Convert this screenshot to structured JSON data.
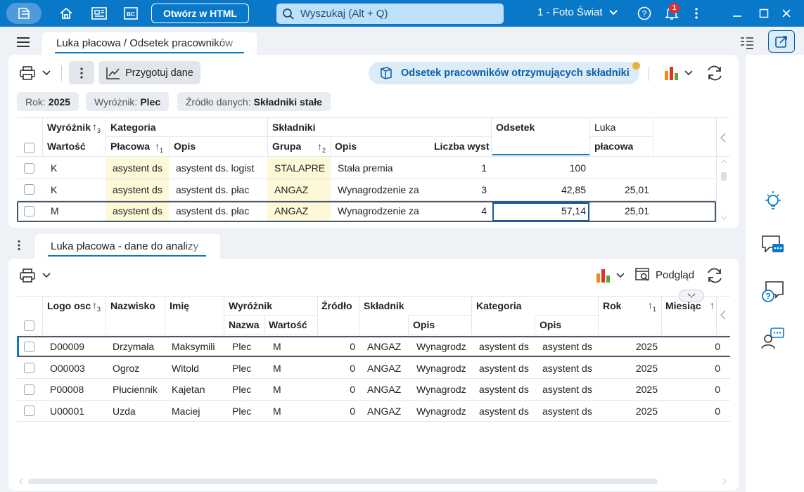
{
  "titlebar": {
    "html_button": "Otwórz w HTML",
    "search_placeholder": "Wyszukaj (Alt + Q)",
    "company": "1 - Foto Świat",
    "notification_count": "1"
  },
  "tabs": {
    "main_tab": "Luka płacowa / Odsetek pracowników",
    "bottom_tab": "Luka płacowa - dane do analizy"
  },
  "toolbar": {
    "prepare_button": "Przygotuj dane",
    "analysis_button": "Odsetek pracowników otrzymujących składniki",
    "preview_button": "Podgląd"
  },
  "filters": [
    {
      "label": "Rok:",
      "value": "2025"
    },
    {
      "label": "Wyróżnik:",
      "value": "Plec"
    },
    {
      "label": "Źródło danych:",
      "value": "Składniki stałe"
    }
  ],
  "top_grid": {
    "group_headers": {
      "wyroznik": "Wyróżnik",
      "kategoria": "Kategoria",
      "skladniki": "Składniki",
      "odsetek": "Odsetek",
      "luka": "Luka"
    },
    "sub_headers": {
      "wartosc": "Wartość",
      "placowa": "Płacowa",
      "opis": "Opis",
      "grupa": "Grupa",
      "opis2": "Opis",
      "liczba": "Liczba wyst",
      "luka2": "płacowa"
    },
    "sort_marks": {
      "wyroznik": "3",
      "placowa": "1",
      "grupa": "2"
    },
    "rows": [
      {
        "wartosc": "K",
        "placowa": "asystent ds",
        "opis": "asystent ds. logist",
        "grupa": "STALAPRE",
        "opis2": "Stała premia",
        "liczba": "1",
        "odsetek": "100",
        "luka": ""
      },
      {
        "wartosc": "K",
        "placowa": "asystent ds",
        "opis": "asystent ds. płac",
        "grupa": "ANGAZ",
        "opis2": "Wynagrodzenie za",
        "liczba": "3",
        "odsetek": "42,85",
        "luka": "25,01"
      },
      {
        "wartosc": "M",
        "placowa": "asystent ds",
        "opis": "asystent ds. płac",
        "grupa": "ANGAZ",
        "opis2": "Wynagrodzenie za",
        "liczba": "4",
        "odsetek": "57,14",
        "luka": "25,01"
      }
    ]
  },
  "bottom_grid": {
    "headers": {
      "logo": "Logo osc",
      "nazwisko": "Nazwisko",
      "imie": "Imię",
      "wyroznik": "Wyróżnik",
      "zrodlo": "Źródło",
      "skladnik": "Składnik",
      "kategoria": "Kategoria",
      "rok": "Rok",
      "miesiac": "Miesiąc"
    },
    "sub_headers": {
      "nazwa": "Nazwa",
      "wartosc": "Wartość",
      "opis": "Opis",
      "opis2": "Opis"
    },
    "sort_marks": {
      "logo": "3",
      "rok": "1"
    },
    "rows": [
      {
        "logo": "D00009",
        "nazwisko": "Drzymała",
        "imie": "Maksymili",
        "nazwa": "Plec",
        "wartosc": "M",
        "zrodlo": "0",
        "skladnik": "ANGAZ",
        "opis": "Wynagrodz",
        "kategoria": "asystent ds",
        "opis2": "asystent ds",
        "rok": "2025",
        "miesiac": "0"
      },
      {
        "logo": "O00003",
        "nazwisko": "Ogroz",
        "imie": "Witold",
        "nazwa": "Plec",
        "wartosc": "M",
        "zrodlo": "0",
        "skladnik": "ANGAZ",
        "opis": "Wynagrodz",
        "kategoria": "asystent ds",
        "opis2": "asystent ds",
        "rok": "2025",
        "miesiac": "0"
      },
      {
        "logo": "P00008",
        "nazwisko": "Płuciennik",
        "imie": "Kajetan",
        "nazwa": "Plec",
        "wartosc": "M",
        "zrodlo": "0",
        "skladnik": "ANGAZ",
        "opis": "Wynagrodz",
        "kategoria": "asystent ds",
        "opis2": "asystent ds",
        "rok": "2025",
        "miesiac": "0"
      },
      {
        "logo": "U00001",
        "nazwisko": "Uzda",
        "imie": "Maciej",
        "nazwa": "Plec",
        "wartosc": "M",
        "zrodlo": "0",
        "skladnik": "ANGAZ",
        "opis": "Wynagrodz",
        "kategoria": "asystent ds",
        "opis2": "asystent ds",
        "rok": "2025",
        "miesiac": "0"
      }
    ]
  },
  "colors": {
    "accent": "#0a78c9",
    "highlight": "#fdf9d7"
  }
}
